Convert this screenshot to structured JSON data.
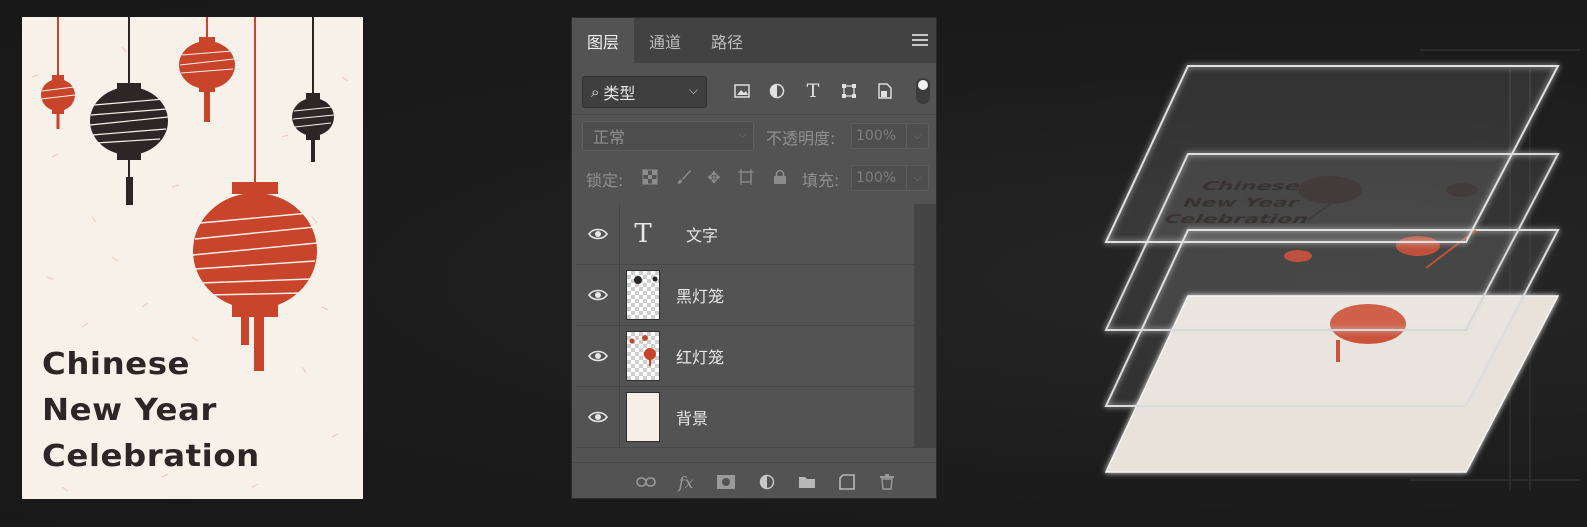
{
  "poster": {
    "title_lines": [
      "Chinese",
      "New Year",
      "Celebration"
    ],
    "colors": {
      "paper": "#f8f1ea",
      "red": "#c8442a",
      "dark": "#2d2626"
    }
  },
  "layers_panel": {
    "tabs": [
      {
        "label": "图层",
        "active": true
      },
      {
        "label": "通道",
        "active": false
      },
      {
        "label": "路径",
        "active": false
      }
    ],
    "menu_icon": "hamburger-icon",
    "filter": {
      "kind_label": "类型",
      "icons": [
        "image-filter-icon",
        "adjustment-filter-icon",
        "type-filter-icon",
        "shape-filter-icon",
        "smart-object-filter-icon"
      ]
    },
    "blend_mode": "正常",
    "opacity_label": "不透明度:",
    "opacity_value": "100%",
    "lock_label": "锁定:",
    "lock_icons": [
      "lock-transparent-icon",
      "lock-paint-icon",
      "lock-move-icon",
      "lock-artboard-icon",
      "lock-all-icon"
    ],
    "fill_label": "填充:",
    "fill_value": "100%",
    "layers": [
      {
        "name": "文字",
        "kind": "text",
        "visible": true
      },
      {
        "name": "黑灯笼",
        "kind": "image",
        "visible": true
      },
      {
        "name": "红灯笼",
        "kind": "image",
        "visible": true
      },
      {
        "name": "背景",
        "kind": "background",
        "visible": true
      }
    ],
    "footer_icons": [
      "link-icon",
      "fx-icon",
      "mask-icon",
      "adjustment-icon",
      "folder-icon",
      "new-layer-icon",
      "trash-icon"
    ],
    "fx_label": "fx"
  },
  "stack_preview": {
    "text_lines": [
      "Chinese",
      "New Year",
      "Celebration"
    ]
  }
}
